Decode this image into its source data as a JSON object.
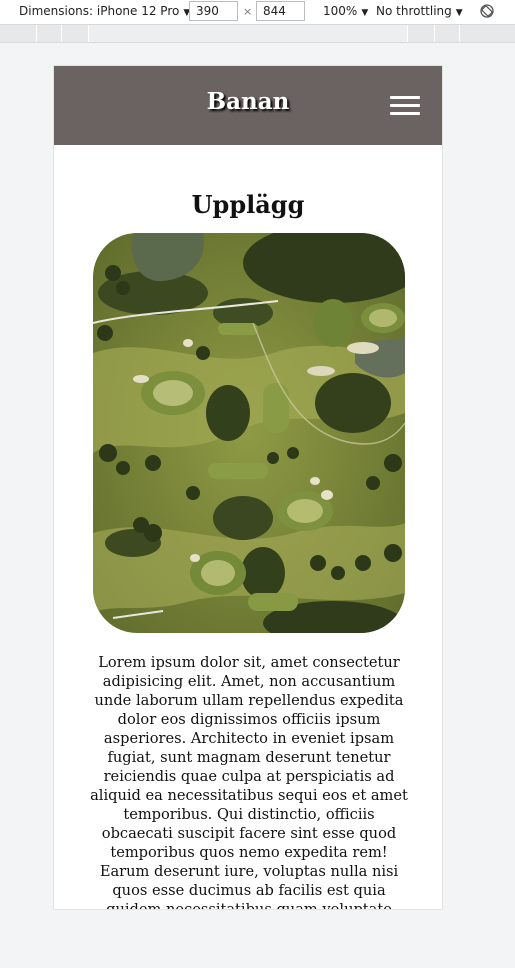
{
  "devtools": {
    "dimensions_label": "Dimensions: iPhone 12 Pro",
    "width_value": "390",
    "height_value": "844",
    "separator": "×",
    "zoom_label": "100%",
    "throttling_label": "No throttling",
    "icons": {
      "rotate": "rotate-icon",
      "caret": "caret-down-icon"
    }
  },
  "site": {
    "brand": "Banan",
    "menu_icon": "hamburger-icon",
    "header_color": "#6b6362",
    "section_title": "Upplägg",
    "image_alt": "Aerial view of a golf course",
    "body": "Lorem ipsum dolor sit, amet consectetur adipisicing elit. Amet, non accusantium unde laborum ullam repellendus expedita dolor eos dignissimos officiis ipsum asperiores. Architecto in eveniet ipsam fugiat, sunt magnam deserunt tenetur reiciendis quae culpa at perspiciatis ad aliquid ea necessitatibus sequi eos et amet temporibus. Qui distinctio, officiis obcaecati suscipit facere sint esse quod temporibus quos nemo expedita rem! Earum deserunt iure, voluptas nulla nisi quos esse ducimus ab facilis est quia quidem necessitatibus quam voluptate"
  }
}
